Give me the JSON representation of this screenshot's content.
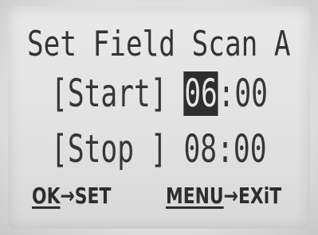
{
  "screen": {
    "title": "Set Field Scan A",
    "start": {
      "label_open": "[",
      "label": "Start",
      "label_close": "]",
      "hour": "06",
      "separator": ":",
      "minute": "00"
    },
    "stop": {
      "label_open": "[",
      "label": "Stop ",
      "label_close": "]",
      "hour": "08",
      "separator": ":",
      "minute": "00"
    },
    "footer": {
      "ok_key": "OK",
      "ok_arrow": "→",
      "ok_action": "SET",
      "menu_key": "MENU",
      "menu_arrow": "→",
      "menu_action": "EXiT"
    }
  },
  "colors": {
    "lcd_background": "#e2e2e2",
    "text": "#333333",
    "highlight_background": "#2e2e2e",
    "highlight_text": "#e6e6e6"
  }
}
